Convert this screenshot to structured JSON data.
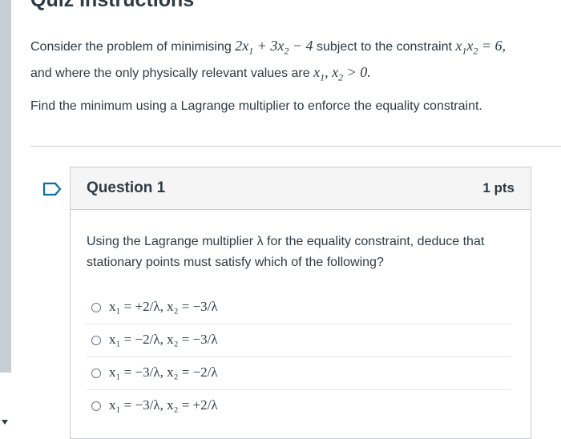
{
  "page_title": "Quiz Instructions",
  "intro": {
    "p1_a": "Consider the problem of minimising ",
    "objective_a": "2x",
    "objective_sub1": "1",
    "objective_b": " + 3x",
    "objective_sub2": "2",
    "objective_c": " − 4",
    "p1_b": " subject to the constraint ",
    "constraint_a": "x",
    "constraint_sub1": "1",
    "constraint_b": "x",
    "constraint_sub2": "2",
    "constraint_c": " = 6,",
    "p1_c": "and where the only physically relevant values are ",
    "domain_a": "x",
    "domain_sub1": "1",
    "domain_b": ", x",
    "domain_sub2": "2",
    "domain_c": " > 0.",
    "p2": "Find the minimum using a Lagrange multiplier to enforce the equality constraint."
  },
  "question": {
    "title": "Question 1",
    "points": "1 pts",
    "text": "Using the Lagrange multiplier λ for the equality constraint, deduce that stationary points must satisfy which of the following?",
    "answers": [
      {
        "label": "x₁ = +2/λ,  x₂ = −3/λ"
      },
      {
        "label": "x₁ = −2/λ,  x₂ = −3/λ"
      },
      {
        "label": "x₁ = −3/λ,  x₂ = −2/λ"
      },
      {
        "label": "x₁ = −3/λ,  x₂ = +2/λ"
      }
    ]
  },
  "colors": {
    "text": "#2d3b45",
    "border": "#c7cdd1",
    "flag": "#0770a3",
    "header_bg": "#f5f5f5"
  },
  "icons": {
    "flag": "flag-icon",
    "radio": "radio-icon"
  }
}
